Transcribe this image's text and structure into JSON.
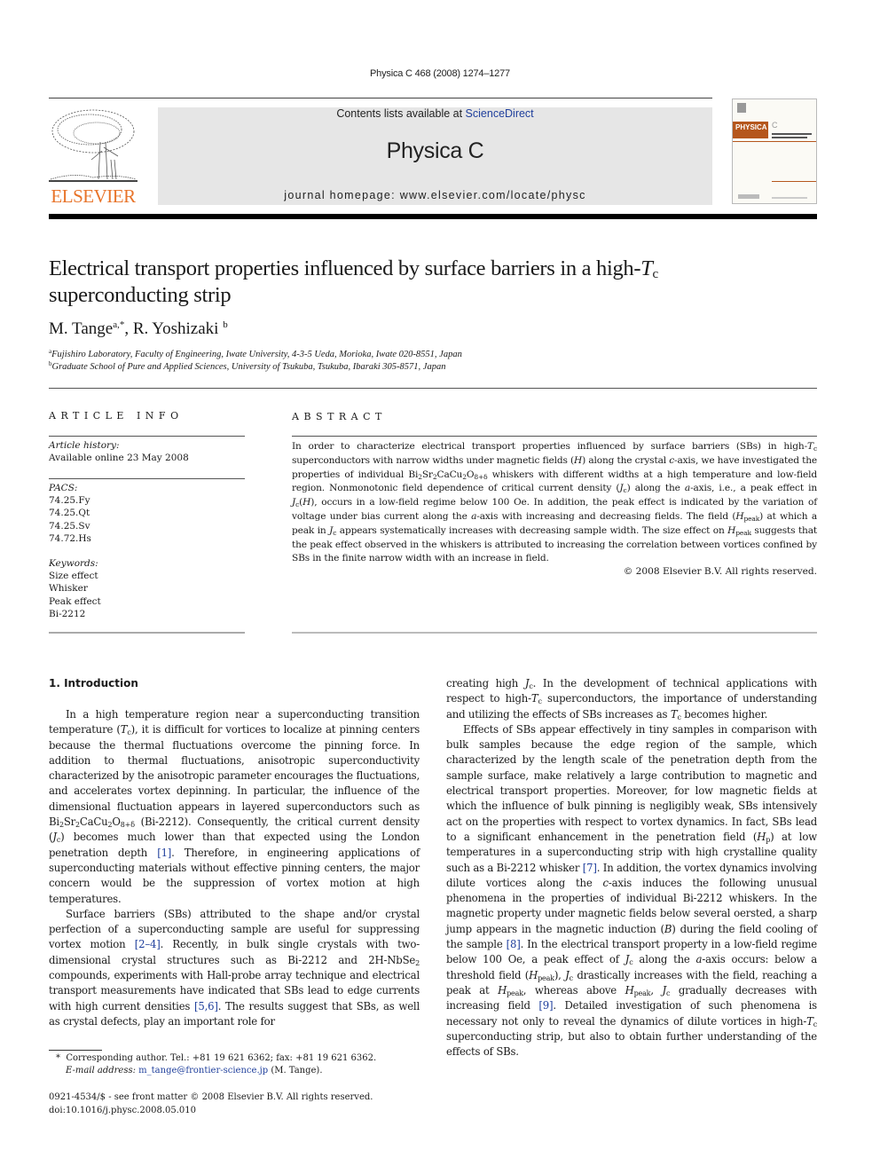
{
  "header": {
    "citation": "Physica C  468 (2008) 1274–1277",
    "contents_prefix": "Contents lists available at ",
    "contents_link": "ScienceDirect",
    "journal_name": "Physica C",
    "homepage": "journal homepage: www.elsevier.com/locate/physc",
    "publisher_logo_text": "ELSEVIER",
    "cover_label": "PHYSICA",
    "cover_letter": "C",
    "brand_color": "#e8742a",
    "link_color": "#1f3f9c"
  },
  "article": {
    "title_main": "Electrical transport properties influenced by surface barriers in a high-",
    "title_T": "T",
    "title_c": "c",
    "title_end": "superconducting strip",
    "authors": [
      {
        "name": "M. Tange",
        "sup": "a,*"
      },
      {
        "name": "R. Yoshizaki",
        "sup": "b"
      }
    ],
    "affiliations": [
      {
        "mark": "a",
        "text": "Fujishiro Laboratory, Faculty of Engineering, Iwate University, 4-3-5 Ueda, Morioka, Iwate 020-8551, Japan"
      },
      {
        "mark": "b",
        "text": "Graduate School of Pure and Applied Sciences, University of Tsukuba, Tsukuba, Ibaraki 305-8571, Japan"
      }
    ]
  },
  "article_info": {
    "heading": "ARTICLE INFO",
    "history_label": "Article history:",
    "history_value": "Available online 23 May 2008",
    "pacs_label": "PACS:",
    "pacs": [
      "74.25.Fy",
      "74.25.Qt",
      "74.25.Sv",
      "74.72.Hs"
    ],
    "keywords_label": "Keywords:",
    "keywords": [
      "Size effect",
      "Whisker",
      "Peak effect",
      "Bi-2212"
    ]
  },
  "abstract": {
    "heading": "ABSTRACT",
    "copyright": "© 2008 Elsevier B.V. All rights reserved."
  },
  "body": {
    "section1_heading": "1. Introduction",
    "refs": [
      "[1]",
      "[2–4]",
      "[5,6]",
      "[7]",
      "[8]",
      "[9]"
    ]
  },
  "footnotes": {
    "corresponding": "Corresponding author. Tel.: +81 19 621 6362; fax: +81 19 621 6362.",
    "email_label": "E-mail address:",
    "email": "m_tange@frontier-science.jp",
    "email_owner": "(M. Tange).",
    "issn": "0921-4534/$ - see front matter © 2008 Elsevier B.V. All rights reserved.",
    "doi": "doi:10.1016/j.physc.2008.05.010"
  }
}
